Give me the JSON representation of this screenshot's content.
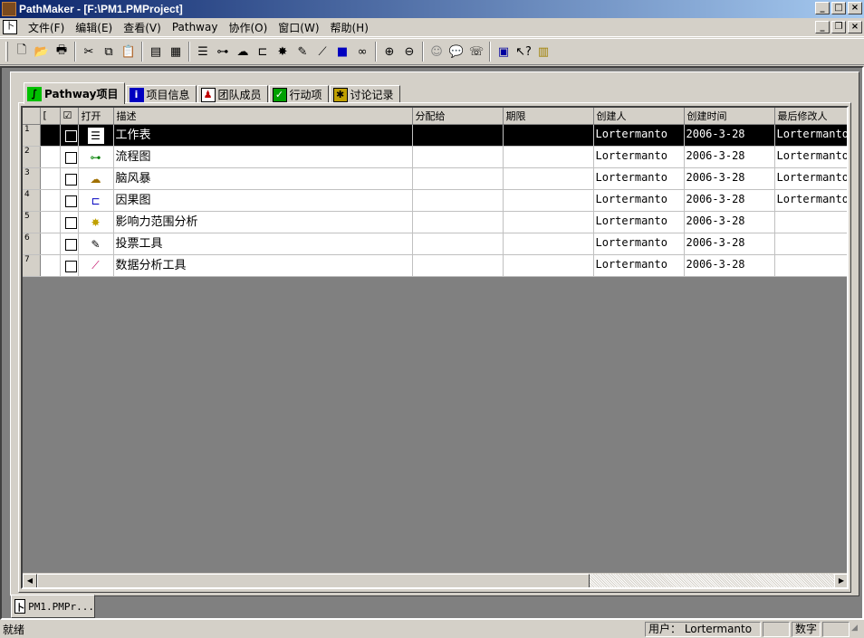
{
  "window": {
    "title": "PathMaker - [F:\\PM1.PMProject]",
    "controls": [
      "_",
      "□",
      "×"
    ],
    "mdi_controls": [
      "_",
      "❐",
      "×"
    ]
  },
  "menu": [
    {
      "label": "文件(F)"
    },
    {
      "label": "编辑(E)"
    },
    {
      "label": "查看(V)"
    },
    {
      "label": "Pathway"
    },
    {
      "label": "协作(O)"
    },
    {
      "label": "窗口(W)"
    },
    {
      "label": "帮助(H)"
    }
  ],
  "tabs": [
    {
      "label": "Pathway项目",
      "icon": "pathway-icon",
      "active": true
    },
    {
      "label": "项目信息",
      "icon": "info-icon"
    },
    {
      "label": "团队成员",
      "icon": "team-icon"
    },
    {
      "label": "行动项",
      "icon": "action-items-icon"
    },
    {
      "label": "讨论记录",
      "icon": "discussion-icon"
    }
  ],
  "grid": {
    "columns": [
      "[",
      "☑",
      "打开",
      "描述",
      "分配给",
      "期限",
      "创建人",
      "创建时间",
      "最后修改人"
    ],
    "rows": [
      {
        "num": "1",
        "icon": "worksheet-icon",
        "desc": "工作表",
        "assigned": "",
        "due": "",
        "creator": "Lortermanto",
        "created": "2006-3-28",
        "modifier": "Lortermanto",
        "selected": true
      },
      {
        "num": "2",
        "icon": "flowchart-icon",
        "desc": "流程图",
        "assigned": "",
        "due": "",
        "creator": "Lortermanto",
        "created": "2006-3-28",
        "modifier": "Lortermanto"
      },
      {
        "num": "3",
        "icon": "brainstorm-icon",
        "desc": "脑风暴",
        "assigned": "",
        "due": "",
        "creator": "Lortermanto",
        "created": "2006-3-28",
        "modifier": "Lortermanto"
      },
      {
        "num": "4",
        "icon": "cause-effect-icon",
        "desc": "因果图",
        "assigned": "",
        "due": "",
        "creator": "Lortermanto",
        "created": "2006-3-28",
        "modifier": "Lortermanto"
      },
      {
        "num": "5",
        "icon": "impact-analysis-icon",
        "desc": "影响力范围分析",
        "assigned": "",
        "due": "",
        "creator": "Lortermanto",
        "created": "2006-3-28",
        "modifier": ""
      },
      {
        "num": "6",
        "icon": "voting-tool-icon",
        "desc": "投票工具",
        "assigned": "",
        "due": "",
        "creator": "Lortermanto",
        "created": "2006-3-28",
        "modifier": ""
      },
      {
        "num": "7",
        "icon": "data-analysis-icon",
        "desc": "数据分析工具",
        "assigned": "",
        "due": "",
        "creator": "Lortermanto",
        "created": "2006-3-28",
        "modifier": ""
      }
    ]
  },
  "mdi_tab": {
    "label": "PM1.PMPr..."
  },
  "status": {
    "main": "就绪",
    "user": "用户： Lortermanto",
    "num": "数字"
  }
}
